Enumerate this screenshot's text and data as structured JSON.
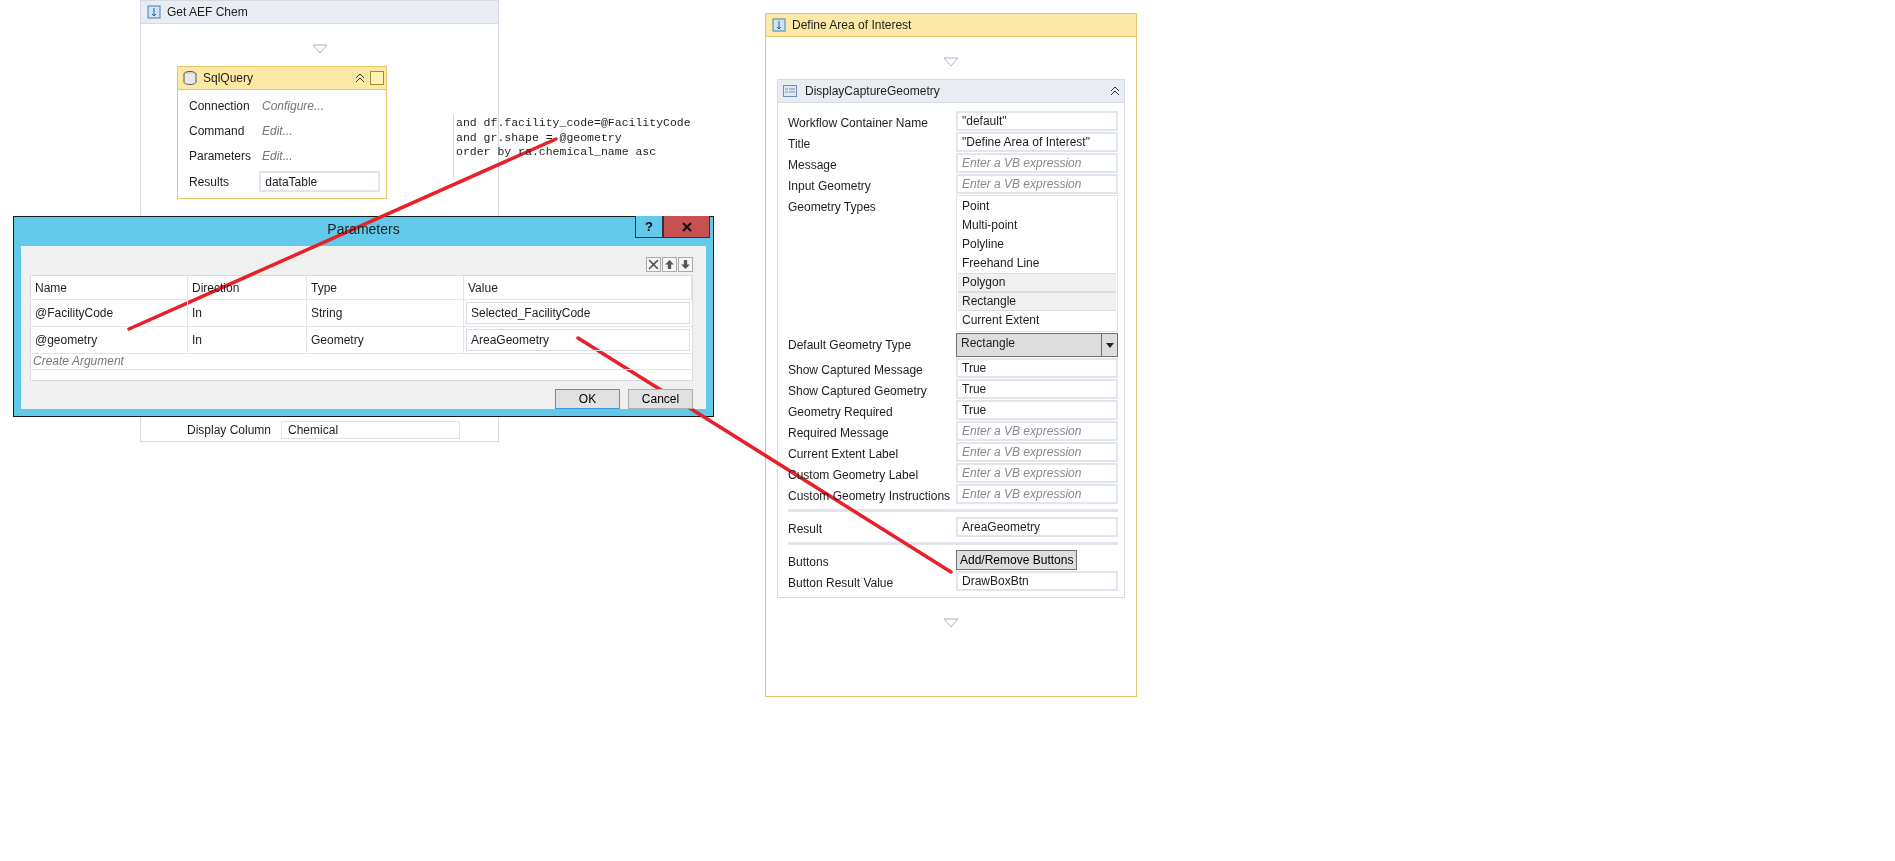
{
  "workflow_sequence": {
    "title": "Get AEF Chem",
    "sql_query": {
      "title": "SqlQuery",
      "properties": [
        {
          "label": "Connection",
          "kind": "link",
          "value": "Configure..."
        },
        {
          "label": "Command",
          "kind": "link",
          "value": "Edit..."
        },
        {
          "label": "Parameters",
          "kind": "link",
          "value": "Edit..."
        },
        {
          "label": "Results",
          "kind": "field",
          "value": "dataTable"
        }
      ]
    },
    "sql_text": [
      "and df.facility_code=@FacilityCode",
      "and gr.shape = @geometry",
      "order by ra.chemical_name asc"
    ],
    "partial_row": {
      "label": "Display Column",
      "value": "Chemical"
    }
  },
  "parameters_dialog": {
    "title": "Parameters",
    "help": "?",
    "columns": [
      "Name",
      "Direction",
      "Type",
      "Value"
    ],
    "rows": [
      {
        "name": "@FacilityCode",
        "direction": "In",
        "type": "String",
        "value": "Selected_FacilityCode"
      },
      {
        "name": "@geometry",
        "direction": "In",
        "type": "Geometry",
        "value": "AreaGeometry"
      }
    ],
    "create_argument": "Create Argument",
    "buttons": [
      "OK",
      "Cancel"
    ]
  },
  "define_area": {
    "title": "Define Area of Interest",
    "activity": {
      "title": "DisplayCaptureGeometry",
      "groups": [
        [
          {
            "label": "Workflow Container Name",
            "kind": "field",
            "value": "\"default\""
          },
          {
            "label": "Title",
            "kind": "field",
            "value": "\"Define Area of Interest\""
          },
          {
            "label": "Message",
            "kind": "field",
            "placeholder": "Enter a VB expression"
          },
          {
            "label": "Input Geometry",
            "kind": "field",
            "placeholder": "Enter a VB expression"
          },
          {
            "label": "Geometry Types",
            "kind": "list",
            "items": [
              {
                "label": "Point",
                "selected": false
              },
              {
                "label": "Multi-point",
                "selected": false
              },
              {
                "label": "Polyline",
                "selected": false
              },
              {
                "label": "Freehand Line",
                "selected": false
              },
              {
                "label": "Polygon",
                "selected": true
              },
              {
                "label": "Rectangle",
                "selected": true
              },
              {
                "label": "Current Extent",
                "selected": false
              }
            ]
          },
          {
            "label": "Default Geometry Type",
            "kind": "dropdown",
            "value": "Rectangle"
          },
          {
            "label": "Show Captured Message",
            "kind": "field",
            "value": "True"
          },
          {
            "label": "Show Captured Geometry",
            "kind": "field",
            "value": "True"
          },
          {
            "label": "Geometry Required",
            "kind": "field",
            "value": "True"
          },
          {
            "label": "Required Message",
            "kind": "field",
            "placeholder": "Enter a VB expression"
          },
          {
            "label": "Current Extent Label",
            "kind": "field",
            "placeholder": "Enter a VB expression"
          },
          {
            "label": "Custom Geometry Label",
            "kind": "field",
            "placeholder": "Enter a VB expression"
          },
          {
            "label": "Custom Geometry Instructions",
            "kind": "field",
            "placeholder": "Enter a VB expression"
          }
        ],
        [
          {
            "label": "Result",
            "kind": "field",
            "value": "AreaGeometry"
          }
        ],
        [
          {
            "label": "Buttons",
            "kind": "button",
            "value": "Add/Remove Buttons"
          },
          {
            "label": "Button Result Value",
            "kind": "field",
            "value": "DrawBoxBtn"
          }
        ]
      ]
    }
  }
}
